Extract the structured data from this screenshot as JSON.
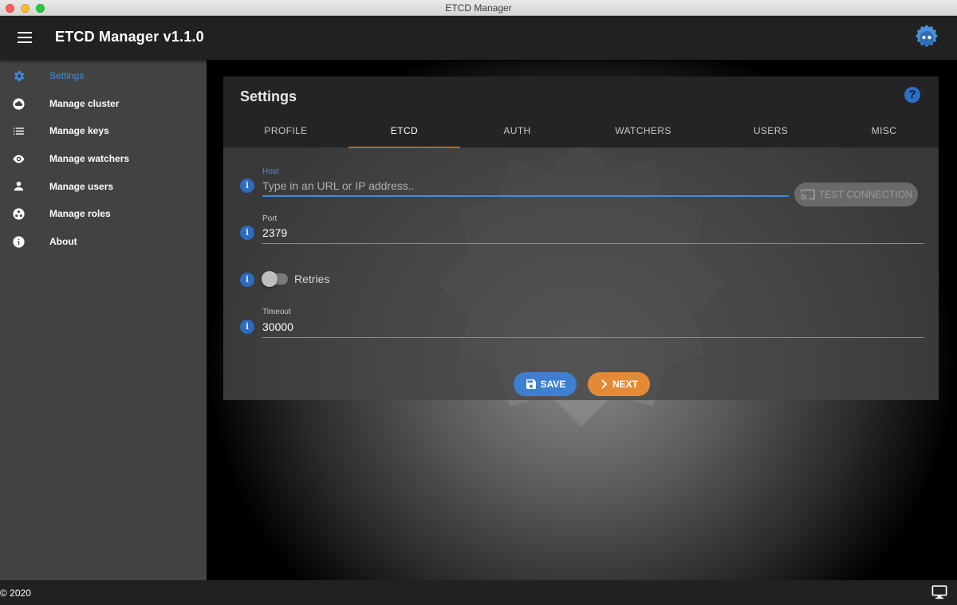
{
  "window": {
    "title": "ETCD Manager"
  },
  "appbar": {
    "title": "ETCD Manager v1.1.0"
  },
  "sidebar": {
    "items": [
      {
        "label": "Settings",
        "icon": "gear-icon",
        "active": true
      },
      {
        "label": "Manage cluster",
        "icon": "cloud-icon"
      },
      {
        "label": "Manage keys",
        "icon": "list-icon"
      },
      {
        "label": "Manage watchers",
        "icon": "eye-icon"
      },
      {
        "label": "Manage users",
        "icon": "person-icon"
      },
      {
        "label": "Manage roles",
        "icon": "roles-icon"
      },
      {
        "label": "About",
        "icon": "info-icon"
      }
    ]
  },
  "settings": {
    "title": "Settings",
    "help_label": "?",
    "tabs": [
      {
        "label": "PROFILE"
      },
      {
        "label": "ETCD",
        "active": true
      },
      {
        "label": "AUTH"
      },
      {
        "label": "WATCHERS"
      },
      {
        "label": "USERS"
      },
      {
        "label": "MISC"
      }
    ],
    "info_glyph": "i",
    "host": {
      "label": "Host",
      "value": "",
      "placeholder": "Type in an URL or IP address.."
    },
    "test_connection_label": "TEST CONNECTION",
    "port": {
      "label": "Port",
      "value": "2379"
    },
    "retries": {
      "label": "Retries",
      "enabled": false
    },
    "timeout": {
      "label": "Timeout",
      "value": "30000"
    },
    "save_label": "SAVE",
    "next_label": "NEXT"
  },
  "footer": {
    "copyright": "© 2020"
  },
  "colors": {
    "accent_blue": "#3e8ee6",
    "accent_orange": "#e88c2f",
    "save_blue": "#3e7fd2",
    "next_orange": "#e48a35"
  }
}
